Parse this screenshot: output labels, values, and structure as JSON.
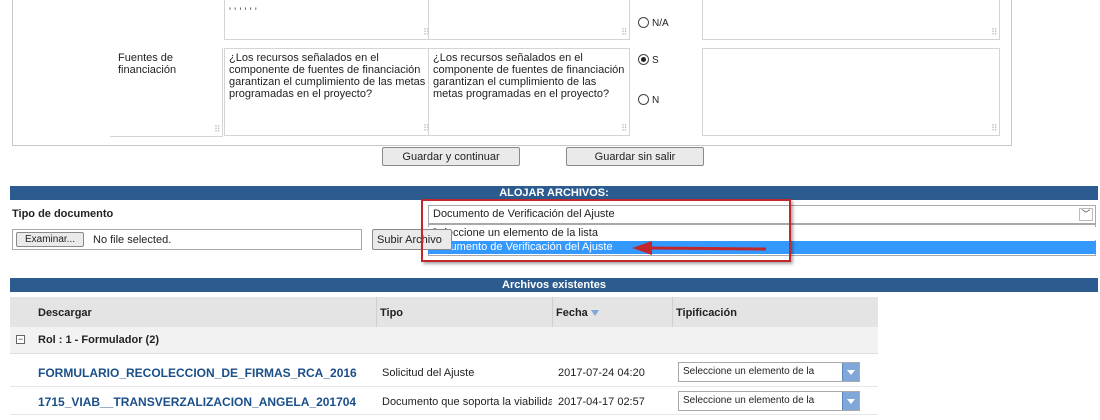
{
  "form": {
    "row1_prev_note": "' ' ' ' ' '",
    "prev_radio_na": "N/A",
    "criterion_label": "Fuentes de financiación",
    "question_text": "¿Los recursos señalados en el componente de fuentes de financiación garantizan el cumplimiento de las metas programadas en el proyecto?",
    "answer_text": "¿Los recursos señalados en el componente de fuentes de financiación garantizan el cumplimiento de las metas programadas en el proyecto?",
    "radio_s": "S",
    "radio_n": "N",
    "save_continue": "Guardar y continuar",
    "save_stay": "Guardar sin salir"
  },
  "upload": {
    "title": "ALOJAR ARCHIVOS:",
    "doc_type_label": "Tipo de documento",
    "doc_type_value": "Documento de Verificación del Ajuste",
    "options": [
      "Seleccione un elemento de la lista",
      "Documento de Verificación del Ajuste"
    ],
    "browse_button": "Examinar...",
    "no_file": "No file selected.",
    "upload_button": "Subir Archivo"
  },
  "files": {
    "title": "Archivos existentes",
    "headers": {
      "download": "Descargar",
      "type": "Tipo",
      "date": "Fecha",
      "typing": "Tipificación"
    },
    "group": "Rol : 1 - Formulador (2)",
    "rows": [
      {
        "name": "FORMULARIO_RECOLECCION_DE_FIRMAS_RCA_2016",
        "type": "Solicitud del Ajuste",
        "date": "2017-07-24 04:20",
        "select": "Seleccione un elemento de la"
      },
      {
        "name": "1715_VIAB__TRANSVERZALIZACION_ANGELA_201704",
        "type": "Documento que soporta la viabilidad",
        "date": "2017-04-17 02:57",
        "select": "Seleccione un elemento de la"
      }
    ]
  },
  "colors": {
    "header_bar": "#2c5b8f",
    "highlight": "#3399ff",
    "annotation": "#c0282d",
    "link": "#1a4f8a"
  }
}
